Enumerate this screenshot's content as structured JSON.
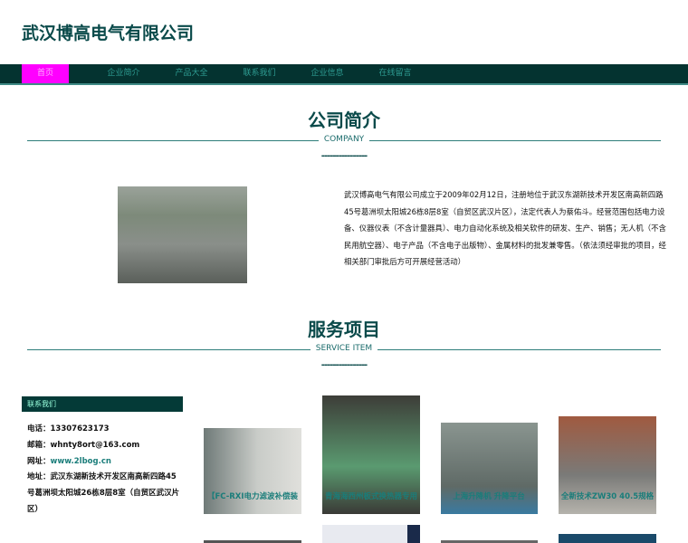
{
  "site_title": "武汉博高电气有限公司",
  "nav": [
    "首页",
    "企业简介",
    "产品大全",
    "联系我们",
    "企业信息",
    "在线留言"
  ],
  "about": {
    "title": "公司简介",
    "subtitle": "COMPANY",
    "dashes": "----------------",
    "text": "武汉博高电气有限公司成立于2009年02月12日，注册地位于武汉东湖新技术开发区南高新四路45号葛洲坝太阳城26栋8层8室（自贸区武汉片区），法定代表人为蔡佑斗。经营范围包括电力设备、仪器仪表（不含计量器具）、电力自动化系统及相关软件的研发、生产、销售；无人机（不含民用航空器）、电子产品（不含电子出版物）、金属材料的批发兼零售。（依法须经审批的项目，经相关部门审批后方可开展经营活动）"
  },
  "service": {
    "title": "服务项目",
    "subtitle": "SERVICE ITEM",
    "dashes": "----------------"
  },
  "contact": {
    "heading": "联系我们",
    "phone": "电话：13307623173",
    "email": "邮箱：whnty8ort@163.com",
    "web_label": "网址：",
    "web": "www.2lbog.cn",
    "address": "地址：武汉东湖新技术开发区南高新四路45号葛洲坝太阳城26栋8层8室（自贸区武汉片区）"
  },
  "products": [
    "【FC-RXI电力滤波补偿装",
    "青海海西州板式换热器专用",
    "上海升降机 升降平台",
    "全新技术ZW30 40.5规格"
  ]
}
